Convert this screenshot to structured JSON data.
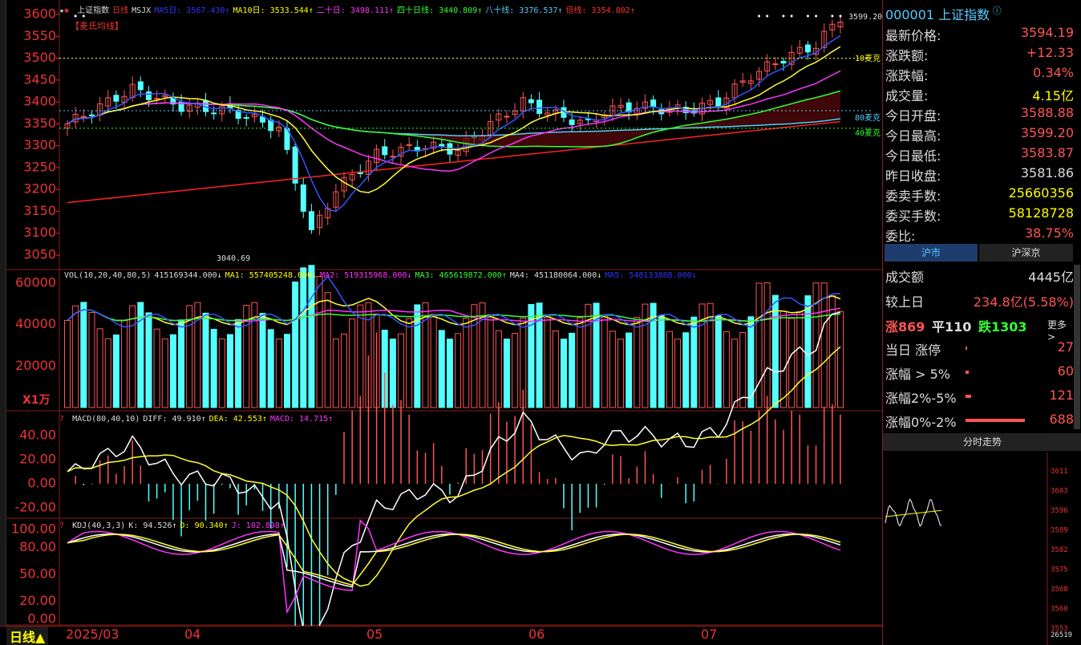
{
  "header": {
    "main": [
      {
        "t": "上证指数",
        "c": "#ddd"
      },
      {
        "t": "日线",
        "c": "#e33"
      },
      {
        "t": "MSJX",
        "c": "#ddd"
      },
      {
        "t": "MA5日: 3567.430↑",
        "c": "#33f"
      },
      {
        "t": "MA10日: 3533.544↑",
        "c": "#ff0"
      },
      {
        "t": "二十日: 3498.111↑",
        "c": "#f3f"
      },
      {
        "t": "四十日线: 3440.809↑",
        "c": "#3f3"
      },
      {
        "t": "八十线: 3376.537↑",
        "c": "#5cf"
      },
      {
        "t": "倍线: 3354.802↑",
        "c": "#f33"
      }
    ],
    "mai_label": "【麦氏均线】",
    "vol": [
      {
        "t": "VOL(10,20,40,80,5)",
        "c": "#ddd"
      },
      {
        "t": "415169344.000↓",
        "c": "#ddd"
      },
      {
        "t": "MA1: 557405248.000↓",
        "c": "#ff0"
      },
      {
        "t": "MA2: 519315968.000↓",
        "c": "#f3f"
      },
      {
        "t": "MA3: 465619872.000↑",
        "c": "#3f3"
      },
      {
        "t": "MA4: 451180064.000↓",
        "c": "#ddd"
      },
      {
        "t": "MA5: 548133888.000↓",
        "c": "#33f"
      }
    ],
    "macd": [
      {
        "t": "MACD(80,40,10)",
        "c": "#ddd"
      },
      {
        "t": "DIFF: 49.910↑",
        "c": "#ddd"
      },
      {
        "t": "DEA: 42.553↑",
        "c": "#ff0"
      },
      {
        "t": "MACD: 14.715↑",
        "c": "#f3f"
      }
    ],
    "kdj": [
      {
        "t": "KDJ(40,3,3)",
        "c": "#ddd"
      },
      {
        "t": "K: 94.526↑",
        "c": "#ddd"
      },
      {
        "t": "D: 90.340↑",
        "c": "#ff0"
      },
      {
        "t": "J: 102.898↑",
        "c": "#f3f"
      }
    ]
  },
  "price_axis": [
    "3600",
    "3550",
    "3500",
    "3450",
    "3400",
    "3350",
    "3300",
    "3250",
    "3200",
    "3150",
    "3100",
    "3050"
  ],
  "vol_axis": [
    "60000",
    "40000",
    "20000"
  ],
  "vol_unit": "X1万",
  "macd_axis": [
    "40.00",
    "20.00",
    "0.00",
    "-20.00"
  ],
  "kdj_axis": [
    "100.00",
    "80.00",
    "50.00",
    "20.00",
    "0.00"
  ],
  "annotations": {
    "high": "3599.20",
    "low": "3040.69",
    "mai10": "10麦克",
    "mai80": "80麦克",
    "mai40": "40麦克"
  },
  "timeframe": "日线▲",
  "x_dates": [
    "2025/03",
    "04",
    "05",
    "06",
    "07"
  ],
  "colors": {
    "up": "#ff5555",
    "down": "#54ffff",
    "ma5": "#3355ff",
    "ma10": "#ffff33",
    "ma20": "#ff33ff",
    "ma40": "#33ff33",
    "ma80": "#55ccff",
    "beixian": "#ff2222"
  },
  "quote": {
    "code_title": "000001 上证指数",
    "rows": [
      {
        "k": "最新价格:",
        "v": "3594.19",
        "c": "#f55"
      },
      {
        "k": "涨跌额:",
        "v": "+12.33",
        "c": "#f55"
      },
      {
        "k": "涨跌幅:",
        "v": "0.34%",
        "c": "#f55"
      },
      {
        "k": "成交量:",
        "v": "4.15亿",
        "c": "#ff0"
      },
      {
        "k": "今日开盘:",
        "v": "3588.88",
        "c": "#f55"
      },
      {
        "k": "今日最高:",
        "v": "3599.20",
        "c": "#f55"
      },
      {
        "k": "今日最低:",
        "v": "3583.87",
        "c": "#f55"
      },
      {
        "k": "昨日收盘:",
        "v": "3581.86",
        "c": "#ddd"
      },
      {
        "k": "委卖手数:",
        "v": "25660356",
        "c": "#ff0"
      },
      {
        "k": "委买手数:",
        "v": "58128728",
        "c": "#ff0"
      },
      {
        "k": "委比:",
        "v": "38.75%",
        "c": "#f55"
      }
    ],
    "tabs": [
      "沪市",
      "沪深京"
    ],
    "market": [
      {
        "k": "成交额",
        "v": "4445亿",
        "c": "#ddd"
      },
      {
        "k": "较上日",
        "v": "234.8亿(5.58%)",
        "c": "#f55"
      }
    ],
    "breadth": {
      "up": "涨869",
      "flat": "平110",
      "down": "跌1303",
      "more": "更多 >"
    },
    "stats": [
      {
        "k": "当日 涨停",
        "v": "27",
        "bar": 0.02
      },
      {
        "k": "涨幅 > 5%",
        "v": "60",
        "bar": 0.03
      },
      {
        "k": "涨幅2%-5%",
        "v": "121",
        "bar": 0.06
      },
      {
        "k": "涨幅0%-2%",
        "v": "688",
        "bar": 0.62
      }
    ],
    "intraday_title": "分时走势",
    "intraday_axis": [
      "3611",
      "3603",
      "3596",
      "3589",
      "3582",
      "3575",
      "3568",
      "3560",
      "3553"
    ],
    "intraday_vol": "26519"
  }
}
